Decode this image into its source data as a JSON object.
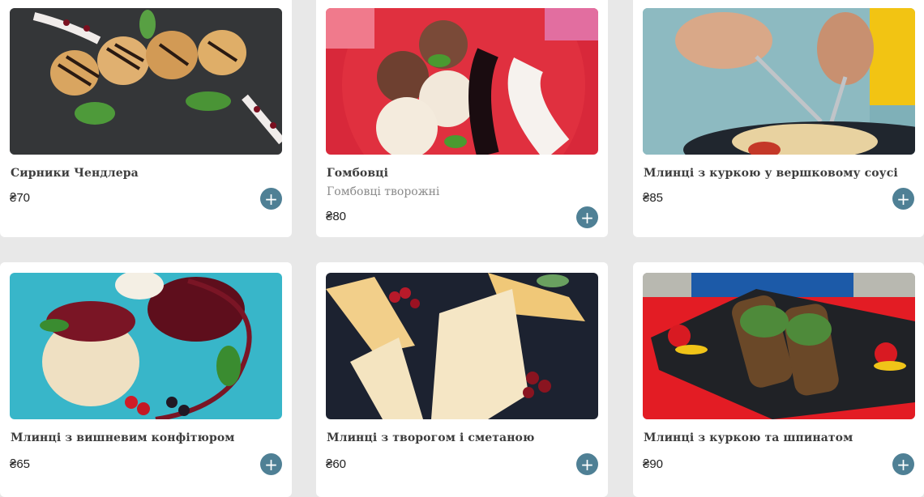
{
  "menu": {
    "items": [
      {
        "name": "Сирники Чендлера",
        "description": "",
        "price": "₴70",
        "add_label": "+",
        "image": "syrnyky-photo"
      },
      {
        "name": "Гомбовці",
        "description": "Гомбовці творожні",
        "price": "₴80",
        "add_label": "+",
        "image": "gombovtsi-photo"
      },
      {
        "name": "Млинці з куркою у вершковому соусі",
        "description": "",
        "price": "₴85",
        "add_label": "+",
        "image": "pancakes-chicken-cream-photo"
      },
      {
        "name": "Млинці з вишневим конфітюром",
        "description": "",
        "price": "₴65",
        "add_label": "+",
        "image": "pancakes-cherry-photo"
      },
      {
        "name": "Млинці з творогом і сметаною",
        "description": "",
        "price": "₴60",
        "add_label": "+",
        "image": "pancakes-curd-photo"
      },
      {
        "name": "Млинці з куркою та шпинатом",
        "description": "",
        "price": "₴90",
        "add_label": "+",
        "image": "pancakes-spinach-photo"
      }
    ]
  },
  "colors": {
    "page_background": "#e8e8e8",
    "card_background": "#ffffff",
    "add_button": "#4f8095",
    "title_text": "#3d3d3d",
    "description_text": "#8a8a8a"
  }
}
